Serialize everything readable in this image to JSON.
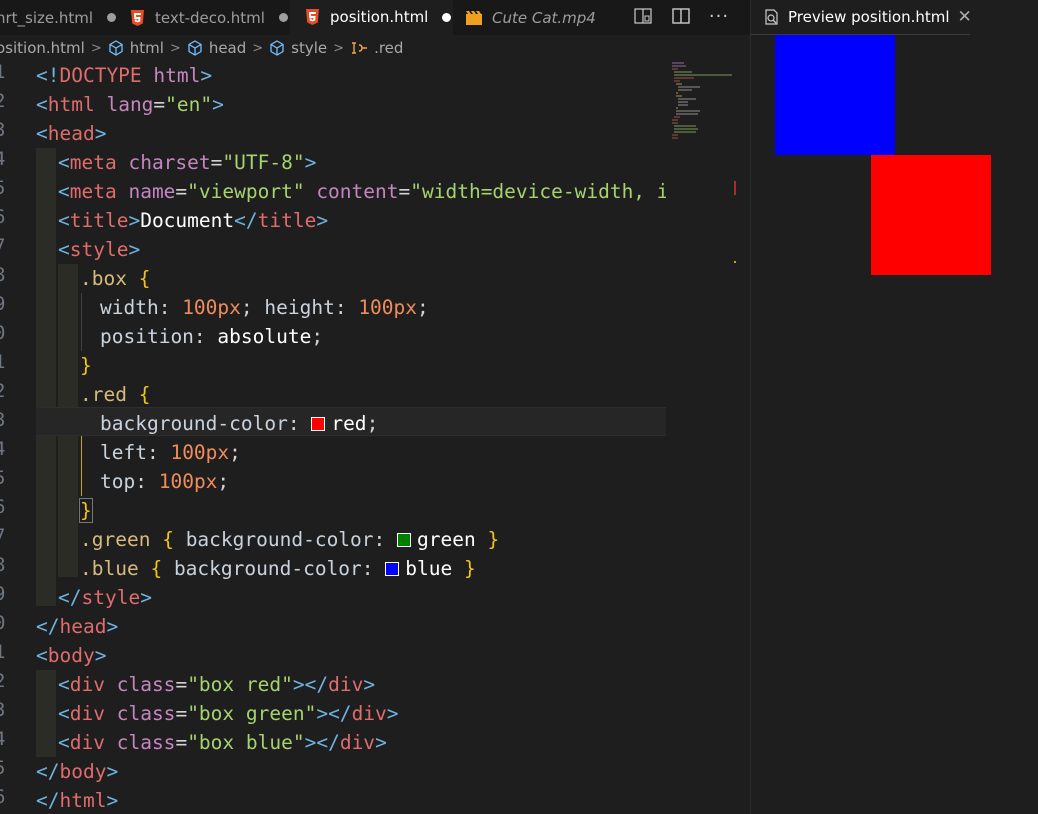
{
  "tabs": [
    {
      "label": "nrt_size.html",
      "state": "modified"
    },
    {
      "label": "text-deco.html",
      "state": "modified"
    },
    {
      "label": "position.html",
      "state": "active-modified"
    },
    {
      "label": "Cute Cat.mp4",
      "state": "preview"
    }
  ],
  "breadcrumb": [
    "osition.html",
    "html",
    "head",
    "style",
    ".red"
  ],
  "line_numbers": [
    "1",
    "2",
    "3",
    "4",
    "5",
    "6",
    "7",
    "8",
    "9",
    "0",
    "1",
    "2",
    "3",
    "4",
    "5",
    "6",
    "7",
    "8",
    "9",
    "0",
    "1",
    "2",
    "3",
    "4",
    "5",
    "6"
  ],
  "code": {
    "l1": {
      "a": "<!",
      "b": "DOCTYPE",
      "c": " html",
      "d": ">"
    },
    "l2": {
      "a": "<",
      "b": "html",
      "c": " lang",
      "d": "=",
      "e": "\"en\"",
      "f": ">"
    },
    "l3": {
      "a": "<",
      "b": "head",
      "c": ">"
    },
    "l4": {
      "a": "<",
      "b": "meta",
      "c": " charset",
      "d": "=",
      "e": "\"UTF-8\"",
      "f": ">"
    },
    "l5": {
      "a": "<",
      "b": "meta",
      "c": " name",
      "d": "=",
      "e": "\"viewport\"",
      "f": " content",
      "g": "=",
      "h": "\"width=device-width, initia"
    },
    "l6": {
      "a": "<",
      "b": "title",
      "c": ">",
      "d": "Document",
      "e": "</",
      "f": "title",
      "g": ">"
    },
    "l7": {
      "a": "<",
      "b": "style",
      "c": ">"
    },
    "l8": {
      "a": ".box",
      "b": " {"
    },
    "l9": {
      "a": "width",
      "b": ": ",
      "c": "100px",
      "d": "; ",
      "e": "height",
      "f": ": ",
      "g": "100px",
      "h": ";"
    },
    "l10": {
      "a": "position",
      "b": ": ",
      "c": "absolute",
      "d": ";"
    },
    "l11": {
      "a": "}"
    },
    "l12": {
      "a": ".red",
      "b": " {"
    },
    "l13": {
      "a": "background-color",
      "b": ": ",
      "c": "red",
      "d": ";"
    },
    "l14": {
      "a": "left",
      "b": ": ",
      "c": "100px",
      "d": ";"
    },
    "l15": {
      "a": "top",
      "b": ": ",
      "c": "100px",
      "d": ";"
    },
    "l16": {
      "a": "}"
    },
    "l17": {
      "a": ".green",
      "b": " { ",
      "c": "background-color",
      "d": ": ",
      "e": "green",
      "f": " }"
    },
    "l18": {
      "a": ".blue",
      "b": " { ",
      "c": "background-color",
      "d": ": ",
      "e": "blue",
      "f": " }"
    },
    "l19": {
      "a": "</",
      "b": "style",
      "c": ">"
    },
    "l20": {
      "a": "</",
      "b": "head",
      "c": ">"
    },
    "l21": {
      "a": "<",
      "b": "body",
      "c": ">"
    },
    "l22": {
      "a": "<",
      "b": "div",
      "c": " class",
      "d": "=",
      "e": "\"box red\"",
      "f": "></",
      "g": "div",
      "h": ">"
    },
    "l23": {
      "a": "<",
      "b": "div",
      "c": " class",
      "d": "=",
      "e": "\"box green\"",
      "f": "></",
      "g": "div",
      "h": ">"
    },
    "l24": {
      "a": "<",
      "b": "div",
      "c": " class",
      "d": "=",
      "e": "\"box blue\"",
      "f": "></",
      "g": "div",
      "h": ">"
    },
    "l25": {
      "a": "</",
      "b": "body",
      "c": ">"
    },
    "l26": {
      "a": "</",
      "b": "html",
      "c": ">"
    }
  },
  "colors": {
    "red": "#ff0000",
    "green": "#008000",
    "blue": "#0000ff"
  },
  "preview": {
    "tab_label": "Preview position.html",
    "boxes": [
      "blue",
      "red"
    ]
  },
  "icons": [
    "html5-icon",
    "video-icon",
    "open-preview-icon",
    "split-editor-icon",
    "more-icon",
    "cube-icon",
    "selector-icon",
    "preview-icon",
    "close-icon"
  ]
}
